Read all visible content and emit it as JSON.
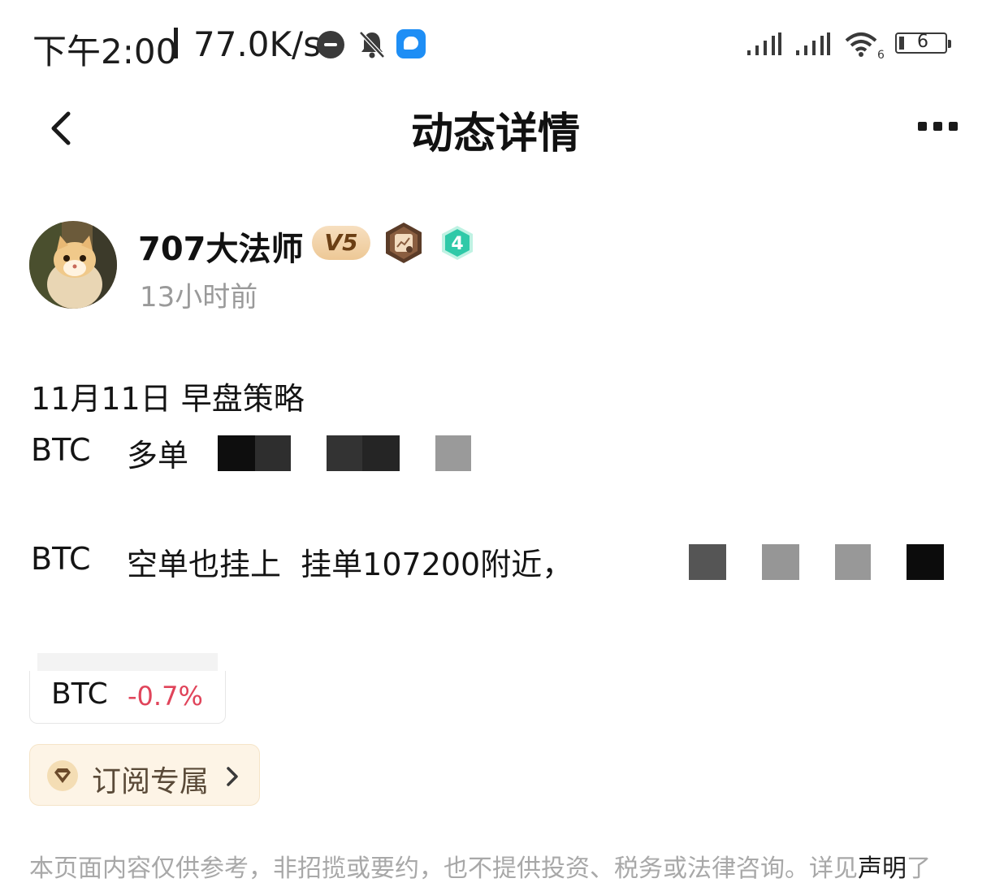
{
  "status_bar": {
    "time": "下午2:00",
    "net_speed": "77.0K/s",
    "wifi_tag": "6",
    "battery": "6"
  },
  "header": {
    "title": "动态详情"
  },
  "author": {
    "name": "707大法师",
    "vip_label": "V5",
    "level": "4",
    "posted_ago": "13小时前"
  },
  "post": {
    "line1": "11月11日 早盘策略",
    "line2_symbol": "BTC",
    "line2_text": "多单",
    "line3_symbol": "BTC",
    "line3_text": "空单也挂上  挂单107200附近，"
  },
  "ticker": {
    "symbol": "BTC",
    "change": "-0.7%",
    "change_color": "#e0445a"
  },
  "subscribe": {
    "label": "订阅专属"
  },
  "disclaimer": {
    "text": "本页面内容仅供参考，非招揽或要约，也不提供投资、税务或法律咨询。详见",
    "link": "声明",
    "tail": "了"
  },
  "colors": {
    "accent_red": "#e0445a",
    "vip_gold": "#edc896",
    "level_teal": "#2fc9a8"
  },
  "icons": [
    "back-arrow-icon",
    "more-icon",
    "medal-icon",
    "level-badge-icon",
    "diamond-icon",
    "chevron-right-icon",
    "dnd-icon",
    "bell-off-icon",
    "signal-icon",
    "wifi-icon",
    "battery-icon"
  ]
}
